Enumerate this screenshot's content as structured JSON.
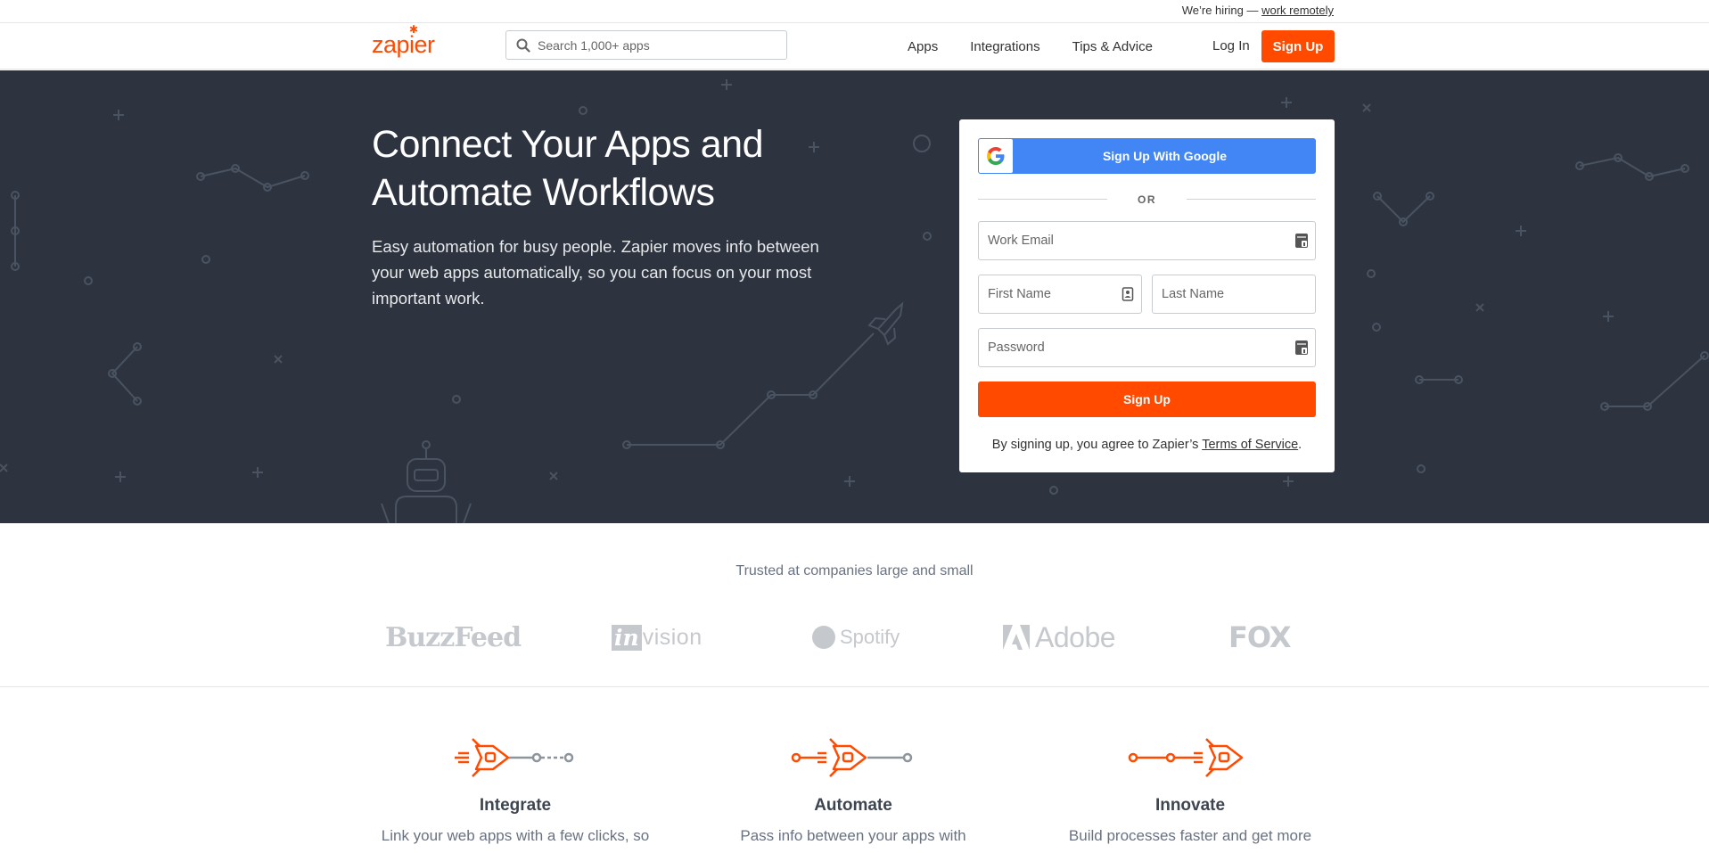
{
  "hiring": {
    "prefix": "We’re hiring —",
    "link": "work remotely"
  },
  "nav": {
    "logo": "zapier",
    "search_placeholder": "Search 1,000+ apps",
    "links": [
      "Apps",
      "Integrations",
      "Tips & Advice"
    ],
    "login": "Log In",
    "signup": "Sign Up"
  },
  "hero": {
    "title": "Connect Your Apps and Automate Workflows",
    "subtitle": "Easy automation for busy people. Zapier moves info between your web apps automatically, so you can focus on your most important work."
  },
  "signup_form": {
    "google_button": "Sign Up With Google",
    "divider": "OR",
    "email_placeholder": "Work Email",
    "first_name_placeholder": "First Name",
    "last_name_placeholder": "Last Name",
    "password_placeholder": "Password",
    "submit": "Sign Up",
    "terms_prefix": "By signing up, you agree to Zapier’s",
    "terms_link": "Terms of Service",
    "terms_suffix": "."
  },
  "trusted": {
    "heading": "Trusted at companies large and small",
    "logos": [
      "BuzzFeed",
      "InVision",
      "Spotify",
      "Adobe",
      "FOX"
    ]
  },
  "features": [
    {
      "title": "Integrate",
      "text": "Link your web apps with a few clicks, so"
    },
    {
      "title": "Automate",
      "text": "Pass info between your apps with"
    },
    {
      "title": "Innovate",
      "text": "Build processes faster and get more"
    }
  ],
  "colors": {
    "brand": "#ff4a00",
    "hero_bg": "#2d3440",
    "google": "#4285f4"
  }
}
